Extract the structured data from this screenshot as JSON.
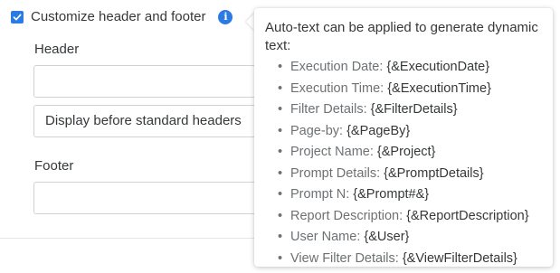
{
  "customize": {
    "checkbox_checked": true,
    "label": "Customize header and footer",
    "info_icon": "info-icon",
    "accent_color": "#2c7be5"
  },
  "header": {
    "label": "Header",
    "input_value": "",
    "position_select": "Display before standard headers"
  },
  "footer": {
    "label": "Footer",
    "input_value": ""
  },
  "tooltip": {
    "intro": "Auto-text can be applied to generate dynamic text:",
    "items": [
      {
        "name": "Execution Date:",
        "code": "{&ExecutionDate}"
      },
      {
        "name": "Execution Time:",
        "code": "{&ExecutionTime}"
      },
      {
        "name": "Filter Details:",
        "code": "{&FilterDetails}"
      },
      {
        "name": "Page-by:",
        "code": "{&PageBy}"
      },
      {
        "name": "Project Name:",
        "code": "{&Project}"
      },
      {
        "name": "Prompt Details:",
        "code": "{&PromptDetails}"
      },
      {
        "name": "Prompt N:",
        "code": "{&Prompt#&}"
      },
      {
        "name": "Report Description:",
        "code": "{&ReportDescription}"
      },
      {
        "name": "User Name:",
        "code": "{&User}"
      },
      {
        "name": "View Filter Details:",
        "code": "{&ViewFilterDetails}"
      }
    ]
  }
}
